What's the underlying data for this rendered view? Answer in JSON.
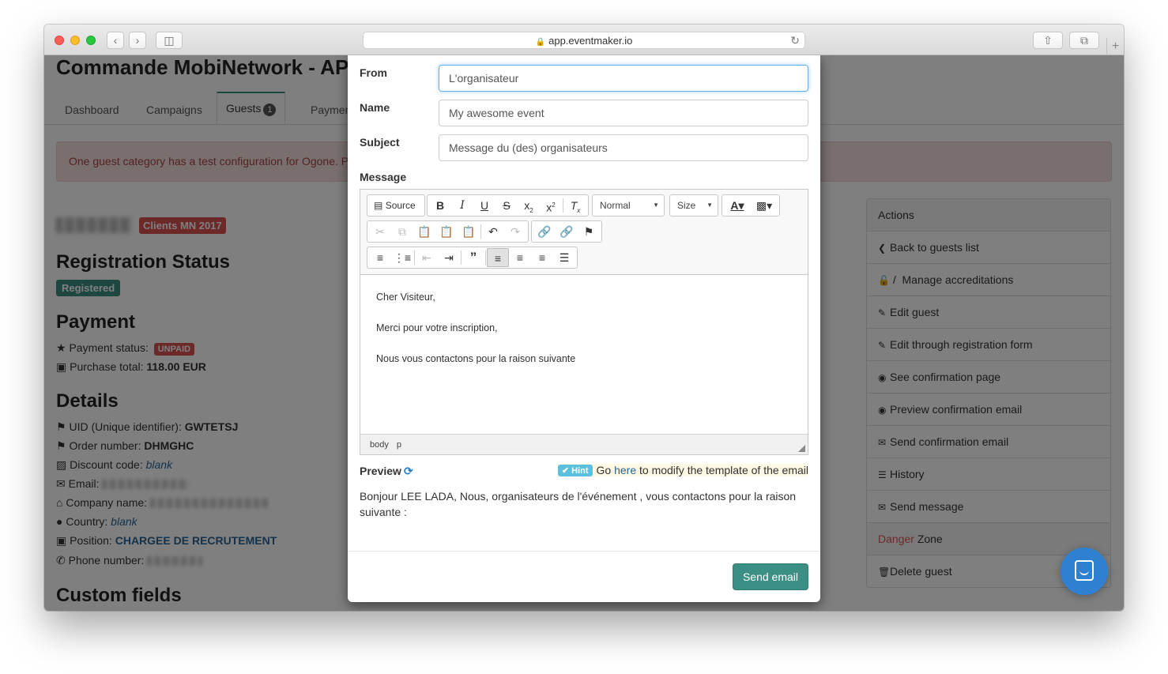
{
  "browser": {
    "url": "app.eventmaker.io"
  },
  "page": {
    "title": "Commande MobiNetwork - APE",
    "tabs": [
      {
        "label": "Dashboard"
      },
      {
        "label": "Campaigns"
      },
      {
        "label": "Guests",
        "badge": "1"
      },
      {
        "label": "Payment"
      }
    ],
    "alert": "One guest category has a test configuration for Ogone. Please update it before going live.",
    "category_badge": "Clients MN 2017",
    "registration_heading": "Registration Status",
    "registration_status": "Registered",
    "payment_heading": "Payment",
    "payment_status_label": "Payment status:",
    "payment_status_value": "UNPAID",
    "purchase_total_label": "Purchase total:",
    "purchase_total_value": "118.00 EUR",
    "details_heading": "Details",
    "uid_label": "UID (Unique identifier):",
    "uid_value": "GWTETSJ",
    "order_label": "Order number:",
    "order_value": "DHMGHC",
    "discount_label": "Discount code:",
    "discount_value": "blank",
    "email_label": "Email:",
    "company_label": "Company name:",
    "country_label": "Country:",
    "country_value": "blank",
    "position_label": "Position:",
    "position_value": "CHARGEE DE RECRUTEMENT",
    "phone_label": "Phone number:",
    "custom_fields_heading": "Custom fields"
  },
  "actions": {
    "title": "Actions",
    "items": [
      {
        "label": "Back to guests list",
        "icon": "chevron-left-icon"
      },
      {
        "label": "/  Manage accreditations",
        "icon": "lock-icon"
      },
      {
        "label": "Edit guest",
        "icon": "pencil-icon"
      },
      {
        "label": "Edit through registration form",
        "icon": "pencil-icon"
      },
      {
        "label": "See confirmation page",
        "icon": "eye-icon"
      },
      {
        "label": "Preview confirmation email",
        "icon": "eye-icon"
      },
      {
        "label": "Send confirmation email",
        "icon": "envelope-icon"
      },
      {
        "label": "History",
        "icon": "list-icon"
      },
      {
        "label": "Send message",
        "icon": "envelope-icon"
      }
    ],
    "danger_word": "Danger",
    "zone_word": "Zone",
    "delete_label": "Delete guest"
  },
  "modal": {
    "from_label": "From",
    "from_value": "L'organisateur",
    "name_label": "Name",
    "name_value": "My awesome event",
    "subject_label": "Subject",
    "subject_value": "Message du (des) organisateurs",
    "message_label": "Message",
    "toolbar": {
      "source_label": "Source",
      "format_combo": "Normal",
      "size_combo": "Size"
    },
    "body_lines": [
      "Cher Visiteur,",
      "Merci pour votre inscription,",
      "Nous vous contactons pour la raison suivante"
    ],
    "path": [
      "body",
      "p"
    ],
    "preview_label": "Preview",
    "hint_label": "Hint",
    "hint_prefix": "Go",
    "hint_link": "here",
    "hint_suffix": "to modify the template of the email",
    "preview_text": "Bonjour LEE LADA, Nous, organisateurs de l'événement , vous contactons pour la raison suivante :",
    "send_label": "Send email"
  }
}
